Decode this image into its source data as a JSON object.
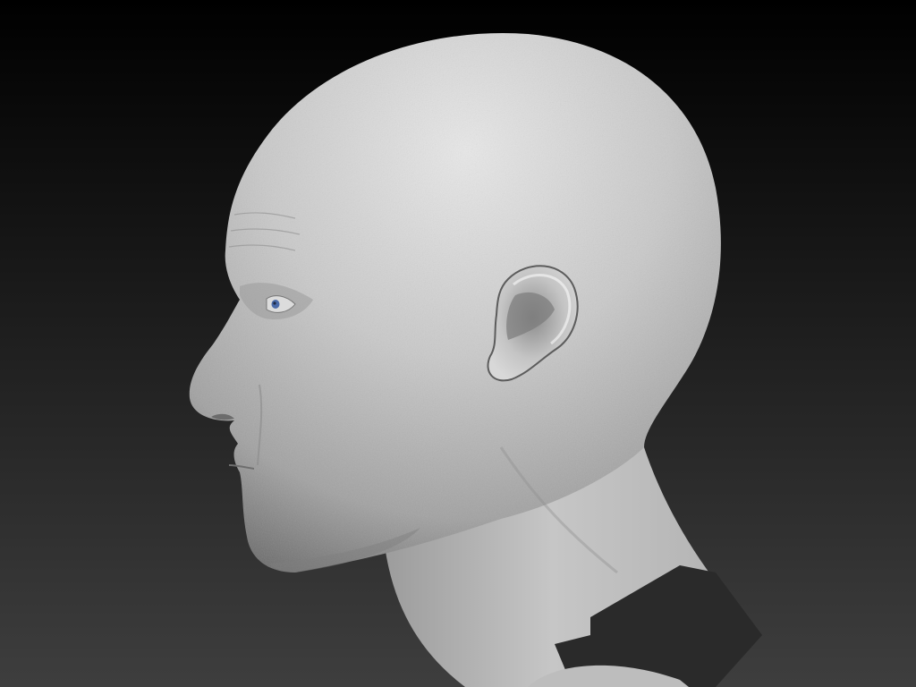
{
  "scene": {
    "subject": "sculpted-head-profile",
    "view": "left-profile",
    "material": "matte-clay",
    "colors": {
      "background_top": "#000000",
      "background_bottom": "#3e3e3e",
      "clay_highlight": "#e6e6e6",
      "clay_mid": "#b7b7b7",
      "clay_shadow": "#6f6f6f",
      "iris": "#4a6aa8",
      "unsculpted_patch": "#2a2a2a"
    }
  }
}
